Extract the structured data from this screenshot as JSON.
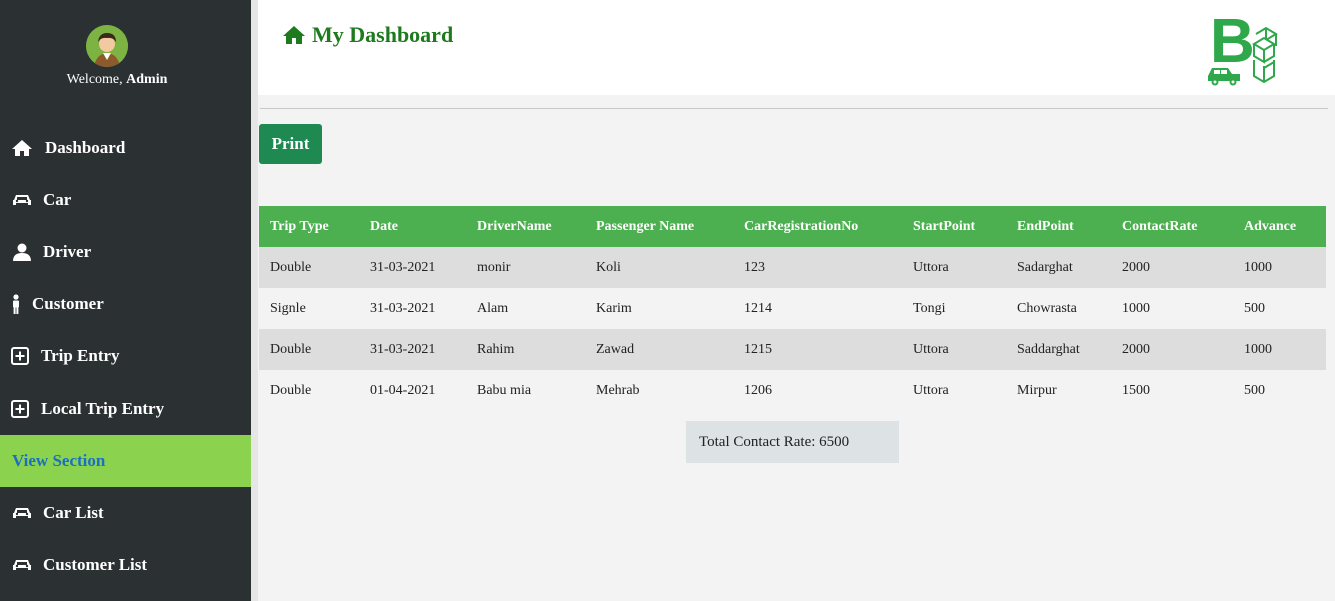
{
  "sidebar": {
    "welcome_prefix": "Welcome, ",
    "user": "Admin",
    "items": [
      {
        "label": "Dashboard",
        "icon": "home-icon"
      },
      {
        "label": "Car",
        "icon": "car-icon"
      },
      {
        "label": "Driver",
        "icon": "user-icon"
      },
      {
        "label": "Customer",
        "icon": "person-icon"
      },
      {
        "label": "Trip Entry",
        "icon": "plus-square-icon"
      },
      {
        "label": "Local Trip Entry",
        "icon": "plus-square-icon"
      },
      {
        "label": "View Section",
        "icon": "",
        "active": true
      },
      {
        "label": "Car List",
        "icon": "car-icon"
      },
      {
        "label": "Customer List",
        "icon": "car-icon"
      }
    ]
  },
  "header": {
    "title": "My Dashboard",
    "logo_text": "B"
  },
  "actions": {
    "print_label": "Print"
  },
  "table": {
    "columns": [
      "Trip Type",
      "Date",
      "DriverName",
      "Passenger Name",
      "CarRegistrationNo",
      "StartPoint",
      "EndPoint",
      "ContactRate",
      "Advance"
    ],
    "rows": [
      [
        "Double",
        "31-03-2021",
        "monir",
        "Koli",
        "123",
        "Uttora",
        "Sadarghat",
        "2000",
        "1000"
      ],
      [
        "Signle",
        "31-03-2021",
        "Alam",
        "Karim",
        "1214",
        "Tongi",
        "Chowrasta",
        "1000",
        "500"
      ],
      [
        "Double",
        "31-03-2021",
        "Rahim",
        "Zawad",
        "1215",
        "Uttora",
        "Saddarghat",
        "2000",
        "1000"
      ],
      [
        "Double",
        "01-04-2021",
        "Babu mia",
        "Mehrab",
        "1206",
        "Uttora",
        "Mirpur",
        "1500",
        "500"
      ]
    ]
  },
  "summary": {
    "total_label": "Total Contact Rate: 6500"
  },
  "colors": {
    "sidebar_bg": "#2b3033",
    "active_bg": "#8bd34f",
    "active_text": "#1a6fc4",
    "title_green": "#1e7a1e",
    "table_header": "#4caf50",
    "print_btn": "#1e8a52"
  }
}
